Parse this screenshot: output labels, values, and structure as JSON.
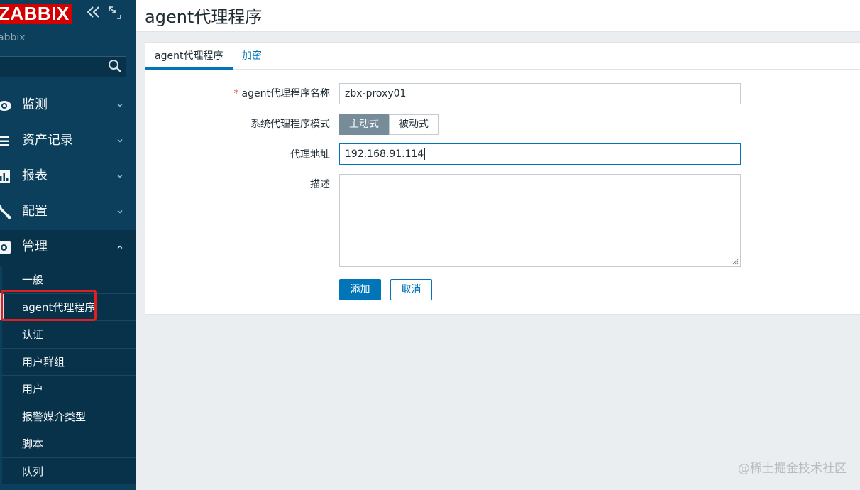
{
  "sidebar": {
    "logo": "ZABBIX",
    "server_name": "abbix",
    "search": {
      "value": "",
      "placeholder": ""
    },
    "menu": [
      {
        "label": "监测",
        "icon": "eye-icon"
      },
      {
        "label": "资产记录",
        "icon": "list-icon"
      },
      {
        "label": "报表",
        "icon": "bar-chart-icon"
      },
      {
        "label": "配置",
        "icon": "wrench-icon"
      },
      {
        "label": "管理",
        "icon": "gear-icon"
      }
    ],
    "submenu": [
      {
        "label": "一般"
      },
      {
        "label": "agent代理程序"
      },
      {
        "label": "认证"
      },
      {
        "label": "用户群组"
      },
      {
        "label": "用户"
      },
      {
        "label": "报警媒介类型"
      },
      {
        "label": "脚本"
      },
      {
        "label": "队列"
      }
    ]
  },
  "header": {
    "title": "agent代理程序"
  },
  "tabs": [
    {
      "label": "agent代理程序"
    },
    {
      "label": "加密"
    }
  ],
  "form": {
    "name_label": "agent代理程序名称",
    "name_required_mark": "*",
    "name_value": "zbx-proxy01",
    "mode_label": "系统代理程序模式",
    "mode_options": [
      "主动式",
      "被动式"
    ],
    "address_label": "代理地址",
    "address_value": "192.168.91.114",
    "description_label": "描述",
    "description_value": ""
  },
  "buttons": {
    "add": "添加",
    "cancel": "取消"
  },
  "watermark": "@稀土掘金技术社区",
  "colors": {
    "sidebar": "#0b3f5b",
    "accent": "#0275b8",
    "logo": "#d40000",
    "highlight": "#e02020"
  }
}
